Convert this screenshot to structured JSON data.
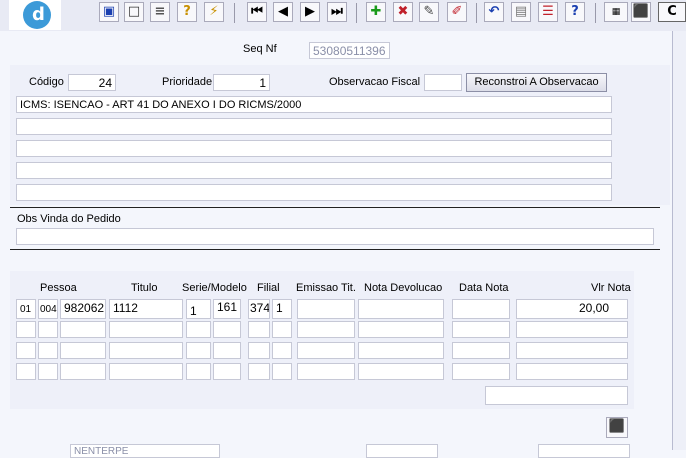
{
  "header": {
    "seq_nf_label": "Seq Nf",
    "seq_nf_value": "53080511396"
  },
  "colors": {
    "accent": "#3c9ad8",
    "panel": "#eef0f9",
    "exit": "#c0202a"
  },
  "toolbar": {
    "icons": [
      "save-icon",
      "window-icon",
      "print-icon",
      "help-query-icon",
      "run-query-icon",
      "first-record-icon",
      "prev-record-icon",
      "next-record-icon",
      "last-record-icon",
      "insert-record-icon",
      "delete-record-icon",
      "edit-record-icon",
      "clear-icon",
      "undo-icon",
      "paste-icon",
      "list-icon",
      "help-icon",
      "menu-icon",
      "exit-icon"
    ]
  },
  "form": {
    "codigo_label": "Código",
    "codigo_value": "24",
    "prioridade_label": "Prioridade",
    "prioridade_value": "1",
    "obs_fiscal_label": "Observacao Fiscal",
    "obs_fiscal_value": "",
    "reconstroi_label": "Reconstroi A Observacao",
    "obs_lines": [
      "ICMS: ISENCAO - ART 41 DO ANEXO I DO RICMS/2000",
      "",
      "",
      "",
      ""
    ],
    "obs_pedido_label": "Obs Vinda do Pedido",
    "obs_pedido_value": ""
  },
  "grid": {
    "headers": {
      "pessoa": "Pessoa",
      "titulo": "Titulo",
      "serie": "Serie/Modelo",
      "filial": "Filial",
      "emissao": "Emissao Tit.",
      "nota_dev": "Nota Devolucao",
      "data_nota": "Data Nota",
      "vlr_nota": "Vlr Nota"
    },
    "rows": [
      {
        "c1": "01",
        "c2": "004",
        "pessoa": "982062",
        "titulo": "1112",
        "serie": "1",
        "modelo": "161",
        "filial1": "374",
        "filial2": "1",
        "emissao": "",
        "nota_dev": "",
        "data_nota": "",
        "vlr_nota": "20,00"
      }
    ]
  },
  "footer": {
    "visible_text": "NENTERPE"
  }
}
